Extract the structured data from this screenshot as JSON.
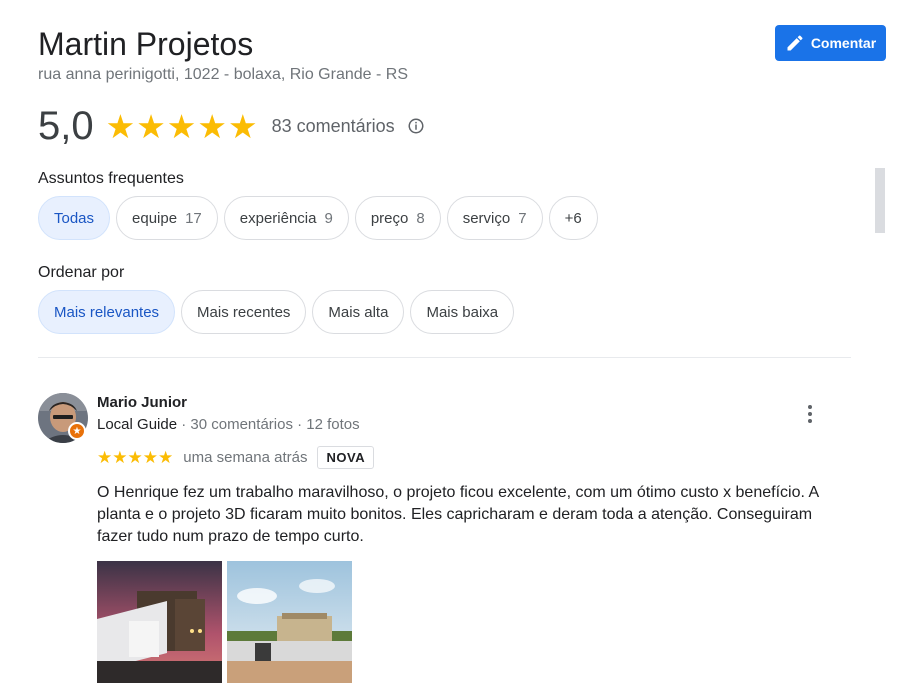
{
  "business": {
    "name": "Martin Projetos",
    "address": "rua anna perinigotti, 1022 - bolaxa, Rio Grande - RS"
  },
  "comment_button": {
    "label": "Comentar",
    "icon": "pencil-icon"
  },
  "rating": {
    "value": "5,0",
    "stars": 5,
    "count_label": "83 comentários",
    "star_color": "#fbbc04"
  },
  "topics": {
    "label": "Assuntos frequentes",
    "chips": [
      {
        "label": "Todas",
        "count": "",
        "selected": true
      },
      {
        "label": "equipe",
        "count": "17",
        "selected": false
      },
      {
        "label": "experiência",
        "count": "9",
        "selected": false
      },
      {
        "label": "preço",
        "count": "8",
        "selected": false
      },
      {
        "label": "serviço",
        "count": "7",
        "selected": false
      },
      {
        "label": "+6",
        "count": "",
        "selected": false
      }
    ]
  },
  "sort": {
    "label": "Ordenar por",
    "options": [
      {
        "label": "Mais relevantes",
        "selected": true
      },
      {
        "label": "Mais recentes",
        "selected": false
      },
      {
        "label": "Mais alta",
        "selected": false
      },
      {
        "label": "Mais baixa",
        "selected": false
      }
    ]
  },
  "review": {
    "author": "Mario Junior",
    "local_guide": "Local Guide",
    "stats": "· 30 comentários · 12 fotos",
    "stars": 5,
    "time": "uma semana atrás",
    "badge": "NOVA",
    "text": "O Henrique fez um trabalho maravilhoso, o projeto ficou excelente, com um ótimo custo x benefício. A planta e o projeto 3D ficaram muito bonitos. Eles capricharam e deram toda a atenção. Conseguiram fazer tudo num prazo de tempo curto."
  },
  "colors": {
    "accent": "#1a73e8",
    "selected_chip_bg": "#e8f0fe",
    "selected_chip_text": "#1a56c4",
    "local_guide_badge": "#e8710a"
  }
}
